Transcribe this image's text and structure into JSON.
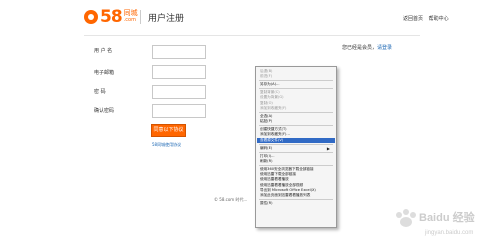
{
  "header": {
    "logo_number": "58",
    "logo_cn": "同城",
    "logo_en": ".com",
    "page_title": "用户注册",
    "links": [
      "返回首页",
      "帮助中心"
    ]
  },
  "form": {
    "fields": [
      {
        "label": "用 户 名",
        "value": ""
      },
      {
        "label": "电子邮箱",
        "value": ""
      },
      {
        "label": "密 码",
        "value": ""
      },
      {
        "label": "确认密码",
        "value": ""
      }
    ],
    "submit_label": "同意以下协议并注册",
    "agreement_link": "58同城使用协议"
  },
  "sidebar": {
    "login_text": "您已经是会员，",
    "login_link": "请登录"
  },
  "footer": {
    "text": "© 58.com 时代..."
  },
  "context_menu": {
    "items": [
      {
        "label": "后退(B)",
        "state": "disabled"
      },
      {
        "label": "前进(F)",
        "state": "disabled"
      },
      {
        "label": "",
        "state": "separator"
      },
      {
        "label": "另存为(A)...",
        "state": "normal"
      },
      {
        "label": "",
        "state": "separator"
      },
      {
        "label": "复制背景(C)",
        "state": "disabled"
      },
      {
        "label": "设置为背景(G)",
        "state": "disabled"
      },
      {
        "label": "复制(O)",
        "state": "disabled"
      },
      {
        "label": "添加到收藏夹(F)",
        "state": "disabled"
      },
      {
        "label": "",
        "state": "separator"
      },
      {
        "label": "全选(A)",
        "state": "normal"
      },
      {
        "label": "粘贴(P)",
        "state": "normal"
      },
      {
        "label": "",
        "state": "separator"
      },
      {
        "label": "创建快捷方式(T)",
        "state": "normal"
      },
      {
        "label": "添加到收藏夹(F)...",
        "state": "normal"
      },
      {
        "label": "查看源文件(V)",
        "state": "highlighted"
      },
      {
        "label": "",
        "state": "separator"
      },
      {
        "label": "编码(E)",
        "state": "submenu"
      },
      {
        "label": "",
        "state": "separator"
      },
      {
        "label": "打印(I)...",
        "state": "normal"
      },
      {
        "label": "刷新(R)",
        "state": "normal"
      },
      {
        "label": "",
        "state": "separator"
      },
      {
        "label": "使用360安全浏览器下载全部链接",
        "state": "normal"
      },
      {
        "label": "使用迅雷下载全部链接",
        "state": "normal"
      },
      {
        "label": "使用迅雷看看播放",
        "state": "normal"
      },
      {
        "label": "使用迅雷看看播放全部视频",
        "state": "normal"
      },
      {
        "label": "导出到 Microsoft Office Excel(X)",
        "state": "normal"
      },
      {
        "label": "添加此页面到迅雷看看播放列表",
        "state": "normal"
      },
      {
        "label": "",
        "state": "separator"
      },
      {
        "label": "属性(R)",
        "state": "normal"
      }
    ]
  },
  "watermark": {
    "brand": "Baidu 经验",
    "url": "jingyan.baidu.com"
  }
}
